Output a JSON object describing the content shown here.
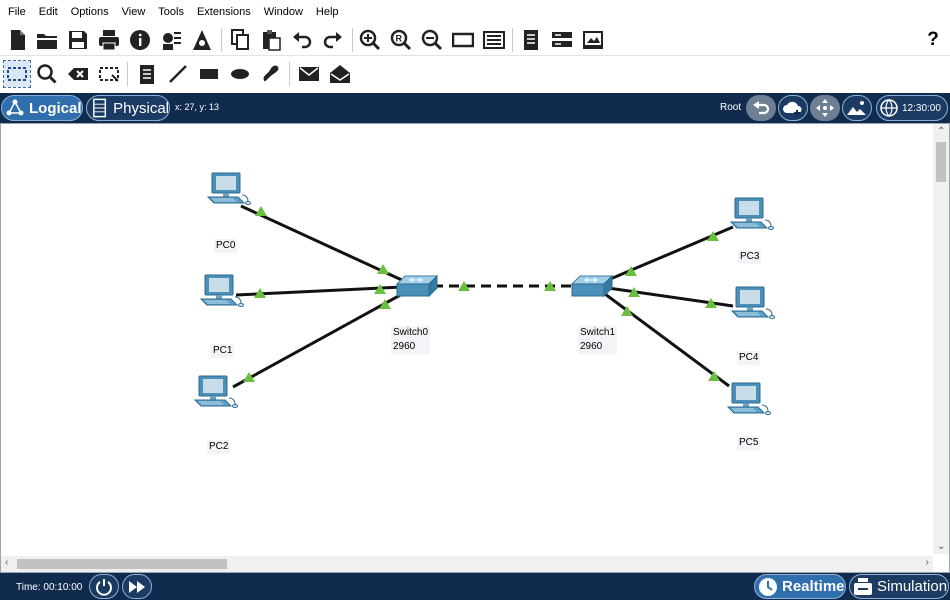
{
  "menu": [
    "File",
    "Edit",
    "Options",
    "View",
    "Tools",
    "Extensions",
    "Window",
    "Help"
  ],
  "toolbar1_icons": [
    "new-file-icon",
    "open-folder-icon",
    "save-icon",
    "print-icon",
    "info-icon",
    "network-wizard-icon",
    "activity-wizard-icon",
    "copy-icon",
    "paste-icon",
    "undo-icon",
    "redo-icon",
    "zoom-in-icon",
    "zoom-reset-icon",
    "zoom-out-icon",
    "viewport-icon",
    "palette-icon",
    "custom-device-icon",
    "cluster-icon",
    "pdu-icon"
  ],
  "help_glyph": "?",
  "toolbar2_icons": [
    "select-icon",
    "inspect-icon",
    "delete-icon",
    "resize-icon",
    "note-icon",
    "line-icon",
    "rectangle-icon",
    "ellipse-icon",
    "freeform-icon",
    "simple-pdu-icon",
    "complex-pdu-icon"
  ],
  "modebar": {
    "logical": "Logical",
    "physical": "Physical",
    "coords": "x: 27, y: 13",
    "root": "Root",
    "clock": "12:30:00"
  },
  "devices": [
    {
      "id": "pc0",
      "label": "PC0",
      "type": "pc"
    },
    {
      "id": "pc1",
      "label": "PC1",
      "type": "pc"
    },
    {
      "id": "pc2",
      "label": "PC2",
      "type": "pc"
    },
    {
      "id": "pc3",
      "label": "PC3",
      "type": "pc"
    },
    {
      "id": "pc4",
      "label": "PC4",
      "type": "pc"
    },
    {
      "id": "pc5",
      "label": "PC5",
      "type": "pc"
    },
    {
      "id": "switch0",
      "label": "Switch0",
      "model": "2960",
      "type": "switch"
    },
    {
      "id": "switch1",
      "label": "Switch1",
      "model": "2960",
      "type": "switch"
    }
  ],
  "links": [
    {
      "from": "pc0",
      "to": "switch0",
      "cable": "straight",
      "status": "up"
    },
    {
      "from": "pc1",
      "to": "switch0",
      "cable": "straight",
      "status": "up"
    },
    {
      "from": "pc2",
      "to": "switch0",
      "cable": "straight",
      "status": "up"
    },
    {
      "from": "switch0",
      "to": "switch1",
      "cable": "crossover",
      "status": "up"
    },
    {
      "from": "switch1",
      "to": "pc3",
      "cable": "straight",
      "status": "up"
    },
    {
      "from": "switch1",
      "to": "pc4",
      "cable": "straight",
      "status": "up"
    },
    {
      "from": "switch1",
      "to": "pc5",
      "cable": "straight",
      "status": "up"
    }
  ],
  "colors": {
    "bar_bg": "#102b4e",
    "active_tab": "#2f6fae",
    "link_up": "#6abf40",
    "device_blue": "#4a90b8"
  },
  "statusbar": {
    "time": "Time: 00:10:00",
    "realtime": "Realtime",
    "simulation": "Simulation"
  }
}
